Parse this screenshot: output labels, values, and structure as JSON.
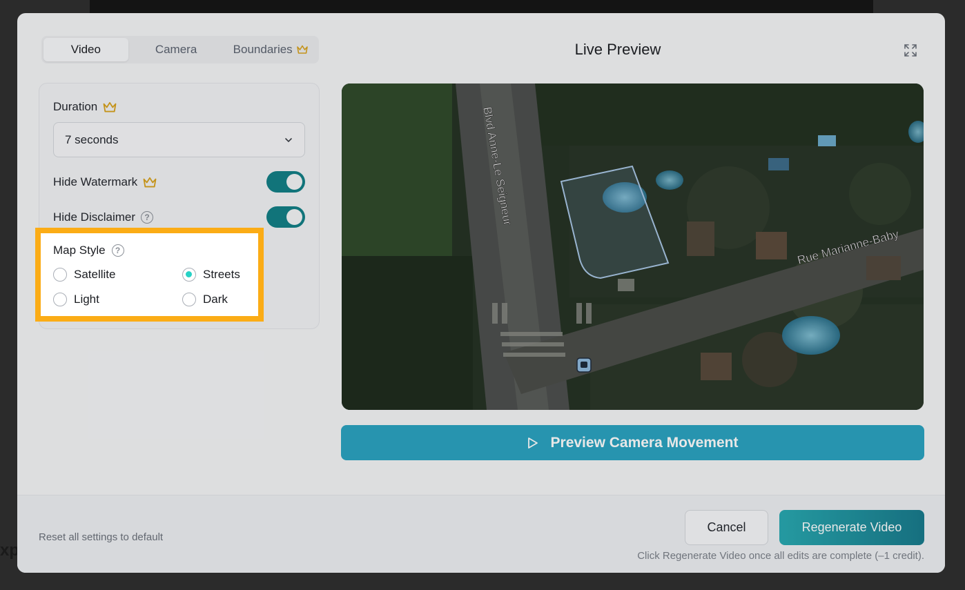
{
  "tabs": [
    {
      "label": "Video",
      "active": true
    },
    {
      "label": "Camera",
      "active": false
    },
    {
      "label": "Boundaries",
      "active": false,
      "premium": true
    }
  ],
  "settings": {
    "duration_label": "Duration",
    "duration_value": "7 seconds",
    "hide_watermark_label": "Hide Watermark",
    "hide_watermark_on": true,
    "hide_disclaimer_label": "Hide Disclaimer",
    "hide_disclaimer_on": true
  },
  "map_style": {
    "label": "Map Style",
    "options": [
      {
        "label": "Satellite",
        "selected": false
      },
      {
        "label": "Streets",
        "selected": true
      },
      {
        "label": "Light",
        "selected": false
      },
      {
        "label": "Dark",
        "selected": false
      }
    ]
  },
  "preview": {
    "title": "Live Preview",
    "street_labels": [
      "Blvd Anne-Le Seigneur",
      "Rue Marianne-Baby"
    ],
    "button_label": "Preview Camera Movement"
  },
  "footer": {
    "reset_label": "Reset all settings to default",
    "cancel_label": "Cancel",
    "regenerate_label": "Regenerate Video",
    "note": "Click Regenerate Video once all edits are complete (–1 credit)."
  },
  "background": {
    "partial_text": "xp"
  },
  "colors": {
    "accent": "#2aa3c1",
    "toggle": "#117f86",
    "highlight": "#fbac16",
    "radio_checked": "#27d2c6",
    "crown": "#d9a21b"
  }
}
